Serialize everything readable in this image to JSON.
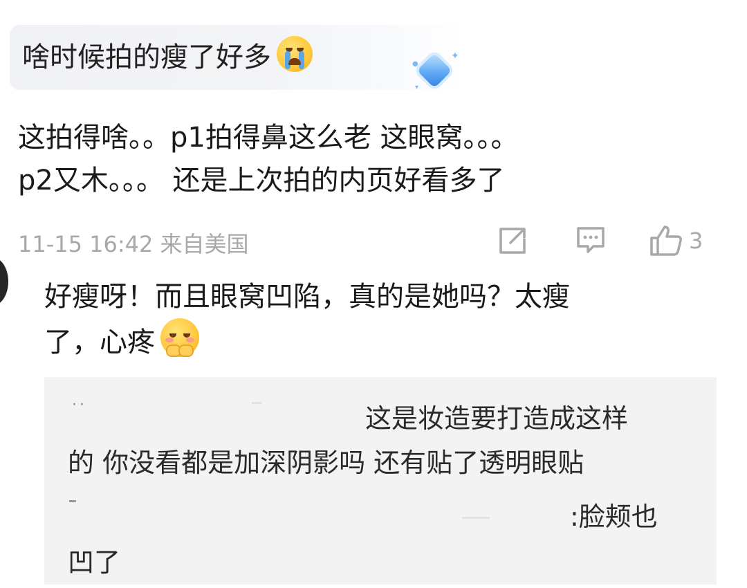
{
  "quote": {
    "text": "啥时候拍的瘦了好多"
  },
  "comment": {
    "lines": [
      "这拍得啥。。p1拍得鼻这么老 这眼窝。。。",
      "p2又木。。。 还是上次拍的内页好看多了"
    ],
    "timestamp": "11-15 16:42",
    "location": "来自美国",
    "like_count": "3"
  },
  "reply": {
    "lines": [
      "好瘦呀！而且眼窝凹陷，真的是她吗？太瘦",
      "了，心疼"
    ]
  },
  "sub_reply": {
    "lines": [
      "这是妆造要打造成这样",
      "的  你没看都是加深阴影吗 还有贴了透明眼贴",
      ":脸颊也",
      "凹了"
    ]
  },
  "icons": {
    "forward": "share-square-icon",
    "comment": "comment-bubble-icon",
    "like": "thumbs-up-icon"
  },
  "colors": {
    "meta_gray": "#a8a8a8",
    "sub_box_bg": "#f3f3f3",
    "text": "#1a1a1a"
  }
}
